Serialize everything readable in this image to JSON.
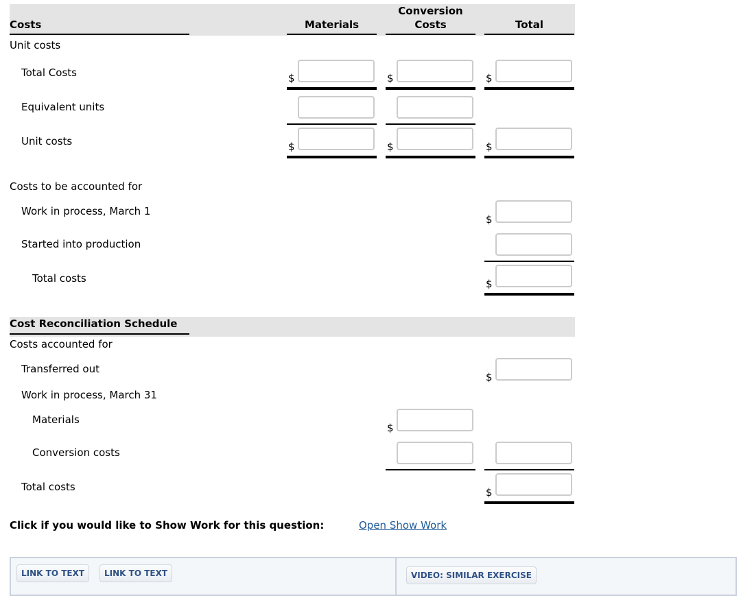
{
  "header": {
    "costs_label": "Costs",
    "materials_label": "Materials",
    "conversion_label_line1": "Conversion",
    "conversion_label_line2": "Costs",
    "total_label": "Total"
  },
  "unit_costs_section": {
    "title": "Unit costs",
    "rows": [
      {
        "label": "Total Costs"
      },
      {
        "label": "Equivalent units"
      },
      {
        "label": "Unit costs"
      }
    ]
  },
  "costs_to_account": {
    "title": "Costs to be accounted for",
    "rows": [
      {
        "label": "Work in process, March 1"
      },
      {
        "label": "Started into production"
      },
      {
        "label": "Total costs"
      }
    ]
  },
  "reconciliation": {
    "title": "Cost Reconciliation Schedule",
    "subtitle": "Costs accounted for",
    "rows": [
      {
        "label": "Transferred out"
      },
      {
        "label": "Work in process, March 31"
      },
      {
        "label": "Materials"
      },
      {
        "label": "Conversion costs"
      },
      {
        "label": "Total costs"
      }
    ]
  },
  "inputs": {
    "value": "",
    "placeholder": ""
  },
  "currency_symbol": "$",
  "show_work": {
    "prompt": "Click if you would like to Show Work for this question:",
    "link_label": "Open Show Work"
  },
  "footer": {
    "link_to_text_1": "LINK TO TEXT",
    "link_to_text_2": "LINK TO TEXT",
    "video_label": "VIDEO: SIMILAR EXERCISE"
  },
  "colors": {
    "header_band": "#e4e4e4",
    "input_border": "#cccccc",
    "link": "#1f5c99",
    "button_text": "#2f5185",
    "panel_bg": "#f4f7fa"
  }
}
